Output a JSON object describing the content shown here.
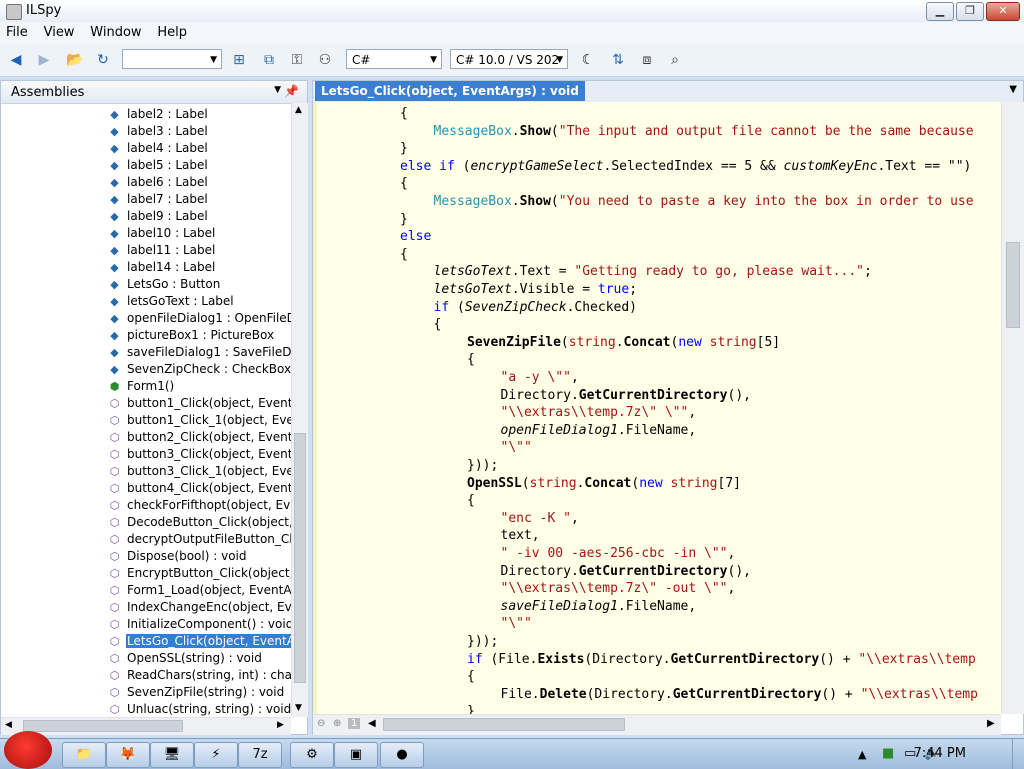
{
  "window": {
    "title": "ILSpy"
  },
  "menu": [
    "File",
    "View",
    "Window",
    "Help"
  ],
  "toolbar": {
    "assembly_list_value": "",
    "language_value": "C#",
    "version_value": "C# 10.0 / VS 202"
  },
  "assemblies_pane": {
    "title": "Assemblies",
    "items": [
      {
        "label": "label2 : Label",
        "icon": "field-icon"
      },
      {
        "label": "label3 : Label",
        "icon": "field-icon"
      },
      {
        "label": "label4 : Label",
        "icon": "field-icon"
      },
      {
        "label": "label5 : Label",
        "icon": "field-icon"
      },
      {
        "label": "label6 : Label",
        "icon": "field-icon"
      },
      {
        "label": "label7 : Label",
        "icon": "field-icon"
      },
      {
        "label": "label9 : Label",
        "icon": "field-icon"
      },
      {
        "label": "label10 : Label",
        "icon": "field-icon"
      },
      {
        "label": "label11 : Label",
        "icon": "field-icon"
      },
      {
        "label": "label14 : Label",
        "icon": "field-icon"
      },
      {
        "label": "LetsGo : Button",
        "icon": "field-icon"
      },
      {
        "label": "letsGoText : Label",
        "icon": "field-icon"
      },
      {
        "label": "openFileDialog1 : OpenFileD",
        "icon": "field-icon"
      },
      {
        "label": "pictureBox1 : PictureBox",
        "icon": "field-icon"
      },
      {
        "label": "saveFileDialog1 : SaveFileDia",
        "icon": "field-icon"
      },
      {
        "label": "SevenZipCheck : CheckBox",
        "icon": "field-icon"
      },
      {
        "label": "Form1()",
        "icon": "constructor-icon"
      },
      {
        "label": "button1_Click(object, EventA",
        "icon": "method-icon"
      },
      {
        "label": "button1_Click_1(object, Ever",
        "icon": "method-icon"
      },
      {
        "label": "button2_Click(object, EventA",
        "icon": "method-icon"
      },
      {
        "label": "button3_Click(object, EventA",
        "icon": "method-icon"
      },
      {
        "label": "button3_Click_1(object, Ever",
        "icon": "method-icon"
      },
      {
        "label": "button4_Click(object, EventA",
        "icon": "method-icon"
      },
      {
        "label": "checkForFifthopt(object, Eve",
        "icon": "method-icon"
      },
      {
        "label": "DecodeButton_Click(object,",
        "icon": "method-icon"
      },
      {
        "label": "decryptOutputFileButton_Cli",
        "icon": "method-icon"
      },
      {
        "label": "Dispose(bool) : void",
        "icon": "method-icon"
      },
      {
        "label": "EncryptButton_Click(object,",
        "icon": "method-icon"
      },
      {
        "label": "Form1_Load(object, EventAr",
        "icon": "method-icon"
      },
      {
        "label": "IndexChangeEnc(object, Eve",
        "icon": "method-icon"
      },
      {
        "label": "InitializeComponent() : void",
        "icon": "method-icon"
      },
      {
        "label": "LetsGo_Click(object, EventAr",
        "icon": "method-icon"
      },
      {
        "label": "OpenSSL(string) : void",
        "icon": "method-icon"
      },
      {
        "label": "ReadChars(string, int) : char",
        "icon": "method-icon"
      },
      {
        "label": "SevenZipFile(string) : void",
        "icon": "method-icon"
      },
      {
        "label": "Unluac(string, string) : void",
        "icon": "method-icon"
      }
    ],
    "selected_index": 31
  },
  "editor": {
    "tab_label": "LetsGo_Click(object, EventArgs) : void",
    "zoom_level": "1",
    "code_lines": [
      {
        "indent": 2,
        "parts": [
          [
            "p",
            "{"
          ]
        ]
      },
      {
        "indent": 3,
        "parts": [
          [
            "t",
            "MessageBox"
          ],
          [
            "p",
            "."
          ],
          [
            "m",
            "Show"
          ],
          [
            "p",
            "("
          ],
          [
            "s",
            "\"The input and output file cannot be the same because"
          ]
        ]
      },
      {
        "indent": 2,
        "parts": [
          [
            "p",
            "}"
          ]
        ]
      },
      {
        "indent": 2,
        "parts": [
          [
            "k",
            "else if"
          ],
          [
            "p",
            " ("
          ],
          [
            "v",
            "encryptGameSelect"
          ],
          [
            "p",
            ".SelectedIndex == 5 && "
          ],
          [
            "v",
            "customKeyEnc"
          ],
          [
            "p",
            ".Text == \"\")"
          ]
        ]
      },
      {
        "indent": 2,
        "parts": [
          [
            "p",
            "{"
          ]
        ]
      },
      {
        "indent": 3,
        "parts": [
          [
            "t",
            "MessageBox"
          ],
          [
            "p",
            "."
          ],
          [
            "m",
            "Show"
          ],
          [
            "p",
            "("
          ],
          [
            "s",
            "\"You need to paste a key into the box in order to use"
          ]
        ]
      },
      {
        "indent": 2,
        "parts": [
          [
            "p",
            "}"
          ]
        ]
      },
      {
        "indent": 2,
        "parts": [
          [
            "k",
            "else"
          ]
        ]
      },
      {
        "indent": 2,
        "parts": [
          [
            "p",
            "{"
          ]
        ]
      },
      {
        "indent": 3,
        "parts": [
          [
            "v",
            "letsGoText"
          ],
          [
            "p",
            ".Text = "
          ],
          [
            "s",
            "\"Getting ready to go, please wait...\""
          ],
          [
            "p",
            ";"
          ]
        ]
      },
      {
        "indent": 3,
        "parts": [
          [
            "v",
            "letsGoText"
          ],
          [
            "p",
            ".Visible = "
          ],
          [
            "k",
            "true"
          ],
          [
            "p",
            ";"
          ]
        ]
      },
      {
        "indent": 3,
        "parts": [
          [
            "k",
            "if"
          ],
          [
            "p",
            " ("
          ],
          [
            "v",
            "SevenZipCheck"
          ],
          [
            "p",
            ".Checked)"
          ]
        ]
      },
      {
        "indent": 3,
        "parts": [
          [
            "p",
            "{"
          ]
        ]
      },
      {
        "indent": 4,
        "parts": [
          [
            "m",
            "SevenZipFile"
          ],
          [
            "p",
            "("
          ],
          [
            "kt",
            "string"
          ],
          [
            "p",
            "."
          ],
          [
            "m",
            "Concat"
          ],
          [
            "p",
            "("
          ],
          [
            "k",
            "new"
          ],
          [
            "p",
            " "
          ],
          [
            "kt",
            "string"
          ],
          [
            "p",
            "[5]"
          ]
        ]
      },
      {
        "indent": 4,
        "parts": [
          [
            "p",
            "{"
          ]
        ]
      },
      {
        "indent": 5,
        "parts": [
          [
            "s",
            "\"a -y \\\"\""
          ],
          [
            "p",
            ","
          ]
        ]
      },
      {
        "indent": 5,
        "parts": [
          [
            "p",
            "Directory."
          ],
          [
            "m",
            "GetCurrentDirectory"
          ],
          [
            "p",
            "(),"
          ]
        ]
      },
      {
        "indent": 5,
        "parts": [
          [
            "s",
            "\"\\\\extras\\\\temp.7z\\\" \\\"\""
          ],
          [
            "p",
            ","
          ]
        ]
      },
      {
        "indent": 5,
        "parts": [
          [
            "v",
            "openFileDialog1"
          ],
          [
            "p",
            ".FileName,"
          ]
        ]
      },
      {
        "indent": 5,
        "parts": [
          [
            "s",
            "\"\\\"\""
          ]
        ]
      },
      {
        "indent": 4,
        "parts": [
          [
            "p",
            "}));"
          ]
        ]
      },
      {
        "indent": 4,
        "parts": [
          [
            "m",
            "OpenSSL"
          ],
          [
            "p",
            "("
          ],
          [
            "kt",
            "string"
          ],
          [
            "p",
            "."
          ],
          [
            "m",
            "Concat"
          ],
          [
            "p",
            "("
          ],
          [
            "k",
            "new"
          ],
          [
            "p",
            " "
          ],
          [
            "kt",
            "string"
          ],
          [
            "p",
            "[7]"
          ]
        ]
      },
      {
        "indent": 4,
        "parts": [
          [
            "p",
            "{"
          ]
        ]
      },
      {
        "indent": 5,
        "parts": [
          [
            "s",
            "\"enc -K \""
          ],
          [
            "p",
            ","
          ]
        ]
      },
      {
        "indent": 5,
        "parts": [
          [
            "p",
            "text,"
          ]
        ]
      },
      {
        "indent": 5,
        "parts": [
          [
            "s",
            "\" -iv 00 -aes-256-cbc -in \\\"\""
          ],
          [
            "p",
            ","
          ]
        ]
      },
      {
        "indent": 5,
        "parts": [
          [
            "p",
            "Directory."
          ],
          [
            "m",
            "GetCurrentDirectory"
          ],
          [
            "p",
            "(),"
          ]
        ]
      },
      {
        "indent": 5,
        "parts": [
          [
            "s",
            "\"\\\\extras\\\\temp.7z\\\" -out \\\"\""
          ],
          [
            "p",
            ","
          ]
        ]
      },
      {
        "indent": 5,
        "parts": [
          [
            "v",
            "saveFileDialog1"
          ],
          [
            "p",
            ".FileName,"
          ]
        ]
      },
      {
        "indent": 5,
        "parts": [
          [
            "s",
            "\"\\\"\""
          ]
        ]
      },
      {
        "indent": 4,
        "parts": [
          [
            "p",
            "}));"
          ]
        ]
      },
      {
        "indent": 4,
        "parts": [
          [
            "k",
            "if"
          ],
          [
            "p",
            " (File."
          ],
          [
            "m",
            "Exists"
          ],
          [
            "p",
            "(Directory."
          ],
          [
            "m",
            "GetCurrentDirectory"
          ],
          [
            "p",
            "() + "
          ],
          [
            "s",
            "\"\\\\extras\\\\temp"
          ]
        ]
      },
      {
        "indent": 4,
        "parts": [
          [
            "p",
            "{"
          ]
        ]
      },
      {
        "indent": 5,
        "parts": [
          [
            "p",
            "File."
          ],
          [
            "m",
            "Delete"
          ],
          [
            "p",
            "(Directory."
          ],
          [
            "m",
            "GetCurrentDirectory"
          ],
          [
            "p",
            "() + "
          ],
          [
            "s",
            "\"\\\\extras\\\\temp"
          ]
        ]
      },
      {
        "indent": 4,
        "parts": [
          [
            "p",
            "}"
          ]
        ]
      }
    ]
  },
  "taskbar": {
    "clock": "7:44 PM"
  }
}
